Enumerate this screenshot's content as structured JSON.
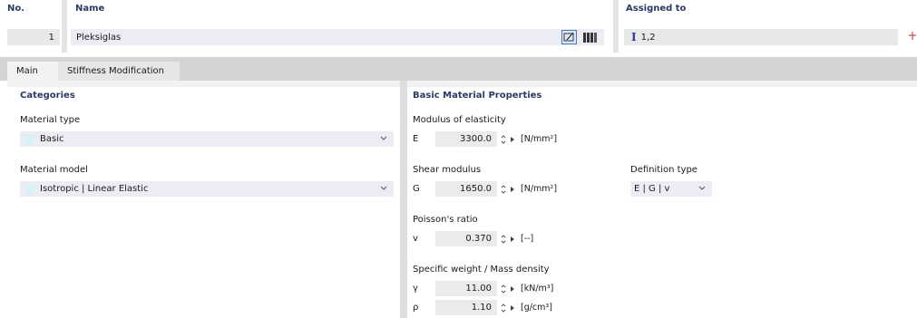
{
  "header": {
    "no_label": "No.",
    "name_label": "Name",
    "assigned_label": "Assigned to",
    "no_value": "1",
    "name_value": "Pleksiglas",
    "assigned_value": "1,2"
  },
  "tabs": [
    {
      "label": "Main",
      "active": true
    },
    {
      "label": "Stiffness Modification",
      "active": false
    }
  ],
  "categories": {
    "title": "Categories",
    "material_type_label": "Material type",
    "material_type_value": "Basic",
    "material_model_label": "Material model",
    "material_model_value": "Isotropic | Linear Elastic"
  },
  "basic": {
    "title": "Basic Material Properties",
    "modulus_label": "Modulus of elasticity",
    "E": {
      "symbol": "E",
      "value": "3300.0",
      "unit": "[N/mm²]"
    },
    "shear_label": "Shear modulus",
    "G": {
      "symbol": "G",
      "value": "1650.0",
      "unit": "[N/mm²]"
    },
    "definition_label": "Definition type",
    "definition_value": "E | G | v",
    "poisson_label": "Poisson's ratio",
    "v": {
      "symbol": "v",
      "value": "0.370",
      "unit": "[--]"
    },
    "specific_label": "Specific weight / Mass density",
    "gamma": {
      "symbol": "γ",
      "value": "11.00",
      "unit": "[kN/m³]"
    },
    "rho": {
      "symbol": "ρ",
      "value": "1.10",
      "unit": "[g/cm³]"
    }
  },
  "colors": {
    "header_text": "#2b3a63",
    "field_bg": "#e8e8e8",
    "dropdown_bg": "#ececf4",
    "tab_strip": "#d4d4d4",
    "section_bg": "#f2f2f2",
    "swatch": "#d8f0f8"
  }
}
